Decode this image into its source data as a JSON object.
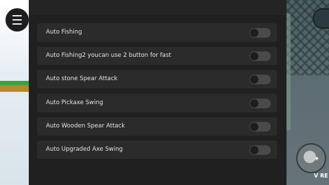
{
  "menu": {
    "items": [
      {
        "label": "Auto Fishing",
        "enabled": false
      },
      {
        "label": "Auto Fishing2 youcan use 2 button for fast",
        "enabled": false
      },
      {
        "label": "Auto stone Spear Attack",
        "enabled": false
      },
      {
        "label": "Auto Pickaxe Swing",
        "enabled": false
      },
      {
        "label": "Auto Wooden Spear Attack",
        "enabled": false
      },
      {
        "label": "Auto Upgraded Axe Swing",
        "enabled": false
      }
    ]
  },
  "overlay": {
    "corner_text": "V RE",
    "sparkle_icon": "✦"
  },
  "colors": {
    "panel_bg": "#202020",
    "row_bg": "#2b2b2b",
    "toggle_off": "#4a4a4a",
    "text": "#e4e4e4"
  }
}
